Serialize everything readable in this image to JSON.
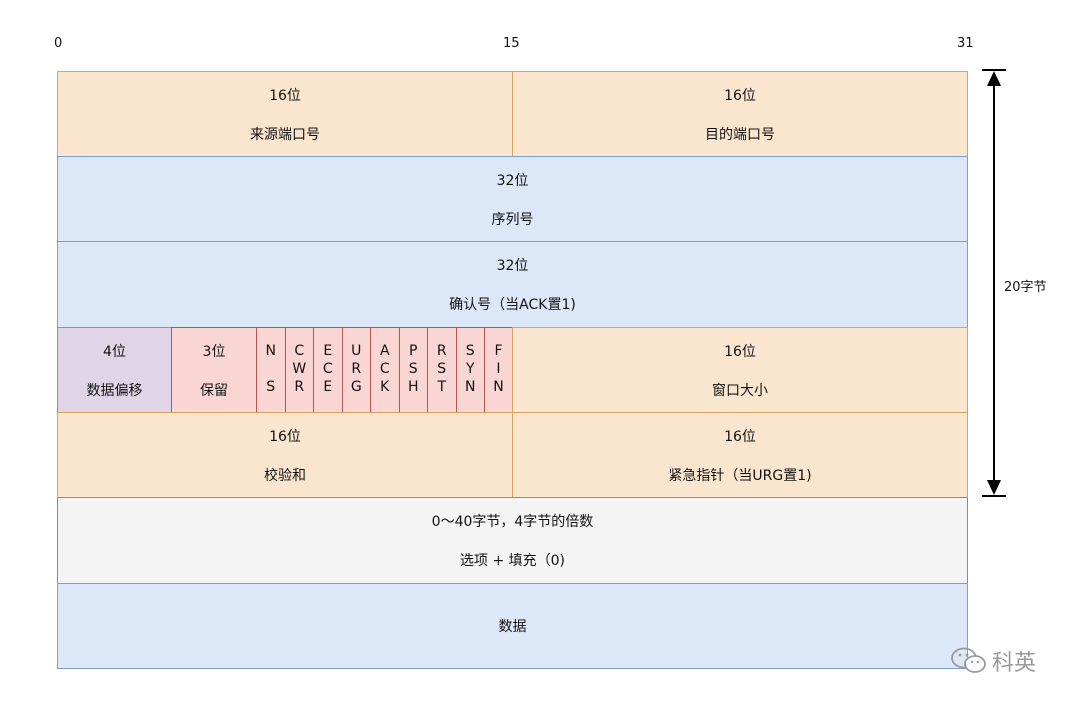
{
  "bit_positions": {
    "start": "0",
    "mid": "15",
    "end": "31"
  },
  "rows": {
    "source_port": {
      "bits": "16位",
      "name": "来源端口号"
    },
    "dest_port": {
      "bits": "16位",
      "name": "目的端口号"
    },
    "sequence": {
      "bits": "32位",
      "name": "序列号"
    },
    "ack_number": {
      "bits": "32位",
      "name": "确认号（当ACK置1)"
    },
    "data_offset": {
      "bits": "4位",
      "name": "数据偏移"
    },
    "reserved": {
      "bits": "3位",
      "name": "保留"
    },
    "flags": [
      {
        "name": "NS",
        "letters": [
          "N",
          "",
          "S"
        ]
      },
      {
        "name": "CWR",
        "letters": [
          "C",
          "W",
          "R"
        ]
      },
      {
        "name": "ECE",
        "letters": [
          "E",
          "C",
          "E"
        ]
      },
      {
        "name": "URG",
        "letters": [
          "U",
          "R",
          "G"
        ]
      },
      {
        "name": "ACK",
        "letters": [
          "A",
          "C",
          "K"
        ]
      },
      {
        "name": "PSH",
        "letters": [
          "P",
          "S",
          "H"
        ]
      },
      {
        "name": "RST",
        "letters": [
          "R",
          "S",
          "T"
        ]
      },
      {
        "name": "SYN",
        "letters": [
          "S",
          "Y",
          "N"
        ]
      },
      {
        "name": "FIN",
        "letters": [
          "F",
          "I",
          "N"
        ]
      }
    ],
    "window": {
      "bits": "16位",
      "name": "窗口大小"
    },
    "checksum": {
      "bits": "16位",
      "name": "校验和"
    },
    "urgent": {
      "bits": "16位",
      "name": "紧急指针（当URG置1)"
    },
    "options": {
      "bits": "0～40字节，4字节的倍数",
      "name": "选项 + 填充（0)"
    },
    "data": {
      "name": "数据"
    }
  },
  "header_size_label": "20字节",
  "watermark": {
    "icon": "wechat-icon",
    "text": "科英"
  },
  "colors": {
    "orange_fill": "#fae6cf",
    "blue_fill": "#dce8f8",
    "purple_fill": "#e0d5e7",
    "red_fill": "#f9d6d4",
    "gray_fill": "#f4f4f4"
  }
}
